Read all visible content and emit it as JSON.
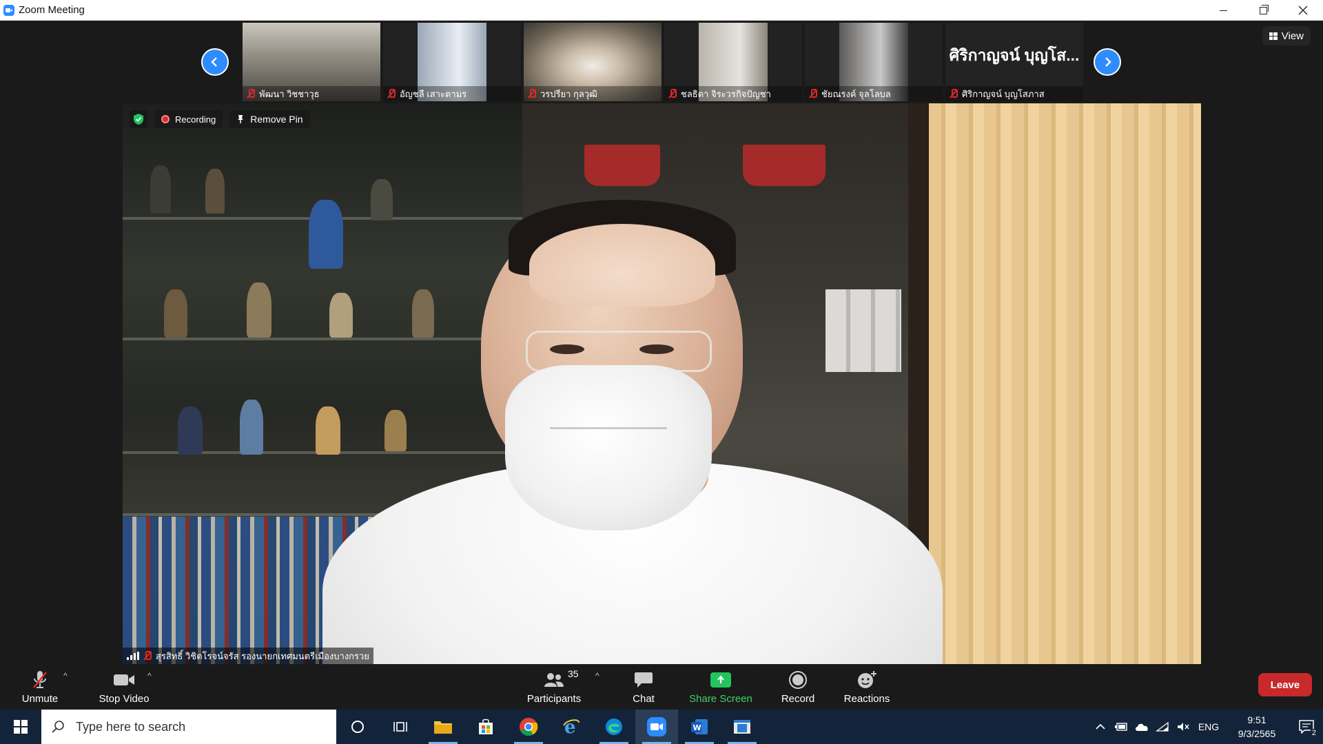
{
  "window": {
    "title": "Zoom Meeting"
  },
  "thumbnails": [
    {
      "name": "พัฒนา วิชชาวุธ",
      "muted": true
    },
    {
      "name": "อัญชลี เสาะตามร",
      "muted": true
    },
    {
      "name": "วรปรียา กุลวุฒิ",
      "muted": true
    },
    {
      "name": "ชลธิดา จิระวรกิจปัญชา",
      "muted": true
    },
    {
      "name": "ชัยณรงค์ จุลโลบล",
      "muted": true
    },
    {
      "name": "ศิริกาญจน์ บุญโสภาส",
      "display_name": "ศิริกาญจน์ บุญโส...",
      "muted": true
    }
  ],
  "view_button": {
    "label": "View"
  },
  "main_video": {
    "recording_label": "Recording",
    "remove_pin_label": "Remove Pin",
    "speaker_name": "สุรสิทธิ์ วิชิตโรจน์จรัส รองนายกเทศมนตรีเมืองบางกรวย"
  },
  "toolbar": {
    "unmute": "Unmute",
    "stop_video": "Stop Video",
    "participants": "Participants",
    "participants_count": "35",
    "chat": "Chat",
    "share_screen": "Share Screen",
    "record": "Record",
    "reactions": "Reactions",
    "leave": "Leave"
  },
  "taskbar": {
    "search_placeholder": "Type here to search",
    "language": "ENG",
    "time": "9:51",
    "date": "9/3/2565",
    "notification_count": "2"
  },
  "colors": {
    "accent": "#2d8cff",
    "leave": "#c8292b",
    "share": "#23c45e",
    "muted": "#e02828",
    "taskbar": "#13243a"
  }
}
